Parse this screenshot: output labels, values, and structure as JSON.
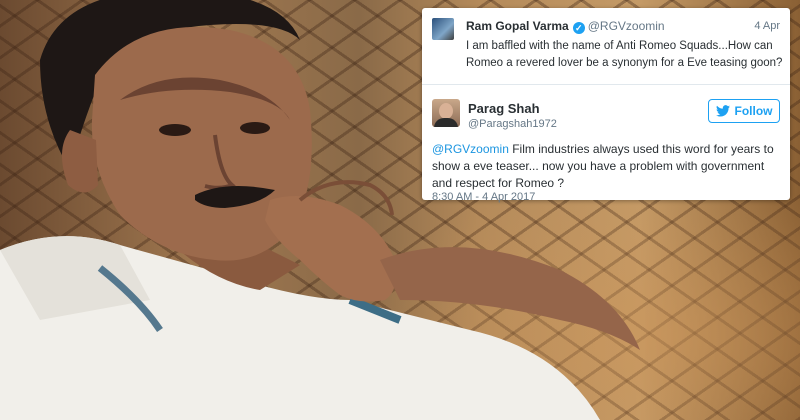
{
  "quoted_tweet": {
    "author_name": "Ram Gopal Varma",
    "handle": "@RGVzoomin",
    "date": "4 Apr",
    "text": "I am baffled with the name of Anti Romeo Squads...How can Romeo a revered lover be a synonym for a Eve teasing goon?"
  },
  "reply_tweet": {
    "author_name": "Parag Shah",
    "handle": "@Paragshah1972",
    "follow_label": "Follow",
    "mention": "@RGVzoomin",
    "text": " Film industries always used this word for years to show a eve teaser... now you have a problem with government and respect for Romeo ?",
    "timestamp": "8:30 AM - 4 Apr 2017"
  },
  "colors": {
    "twitter_blue": "#1da1f2",
    "link_blue": "#1b95e0",
    "text": "#292f33",
    "muted": "#657786"
  },
  "icons": [
    "verified-badge-icon",
    "twitter-bird-icon"
  ]
}
